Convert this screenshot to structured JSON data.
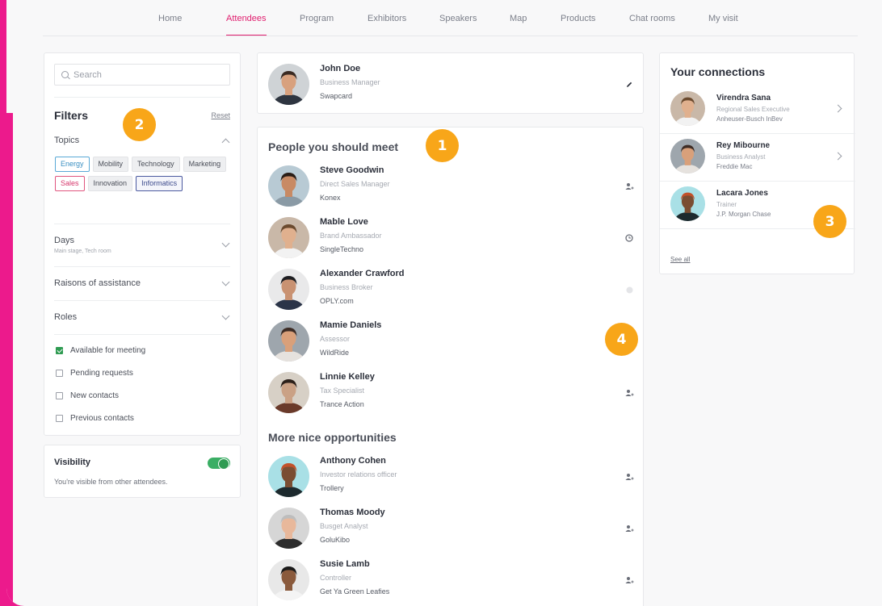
{
  "nav": {
    "items": [
      "Home",
      "Attendees",
      "Program",
      "Exhibitors",
      "Speakers",
      "Map",
      "Products",
      "Chat rooms",
      "My visit"
    ],
    "active": "Attendees"
  },
  "filters": {
    "search_placeholder": "Search",
    "title": "Filters",
    "reset": "Reset",
    "topics_label": "Topics",
    "tags": [
      {
        "label": "Energy",
        "style": "blue"
      },
      {
        "label": "Mobility",
        "style": "plain"
      },
      {
        "label": "Technology",
        "style": "plain"
      },
      {
        "label": "Marketing",
        "style": "plain"
      },
      {
        "label": "Sales",
        "style": "pink"
      },
      {
        "label": "Innovation",
        "style": "plain"
      },
      {
        "label": "Informatics",
        "style": "navy"
      }
    ],
    "days_label": "Days",
    "days_sub": "Main stage, Tech room",
    "raisons_label": "Raisons of assistance",
    "roles_label": "Roles",
    "checks": [
      {
        "label": "Available for meeting",
        "checked": true
      },
      {
        "label": "Pending requests",
        "checked": false
      },
      {
        "label": "New contacts",
        "checked": false
      },
      {
        "label": "Previous contacts",
        "checked": false
      }
    ]
  },
  "visibility": {
    "title": "Visibility",
    "subtitle": "You're visible from other attendees.",
    "enabled": true
  },
  "me": {
    "name": "John Doe",
    "role": "Business Manager",
    "company": "Swapcard"
  },
  "people": {
    "section1_title": "People you should meet",
    "section2_title": "More nice opportunities",
    "list1": [
      {
        "name": "Steve Goodwin",
        "role": "Direct Sales Manager",
        "company": "Konex",
        "icon": "person-add-icon"
      },
      {
        "name": "Mable Love",
        "role": "Brand Ambassador",
        "company": "SingleTechno",
        "icon": "clock-icon"
      },
      {
        "name": "Alexander Crawford",
        "role": "Business Broker",
        "company": "OPLY.com",
        "icon": "dot-icon"
      },
      {
        "name": "Mamie Daniels",
        "role": "Assessor",
        "company": "WildRide",
        "icon": ""
      },
      {
        "name": "Linnie Kelley",
        "role": "Tax Specialist",
        "company": "Trance Action",
        "icon": "person-add-icon"
      }
    ],
    "list2": [
      {
        "name": "Anthony Cohen",
        "role": "Investor relations officer",
        "company": "Trollery",
        "icon": "person-add-icon"
      },
      {
        "name": "Thomas Moody",
        "role": "Busget Analyst",
        "company": "GoluKibo",
        "icon": "person-add-icon"
      },
      {
        "name": "Susie Lamb",
        "role": "Controller",
        "company": "Get Ya Green Leafies",
        "icon": "person-add-icon"
      }
    ]
  },
  "connections": {
    "title": "Your connections",
    "items": [
      {
        "name": "Virendra Sana",
        "role": "Regional Sales Executive",
        "company": "Anheuser-Busch InBev"
      },
      {
        "name": "Rey Mibourne",
        "role": "Business Analyst",
        "company": "Freddie Mac"
      },
      {
        "name": "Lacara Jones",
        "role": "Trainer",
        "company": "J.P. Morgan Chase"
      }
    ],
    "see_all": "See all"
  },
  "badges": [
    "1",
    "2",
    "3",
    "4"
  ],
  "colors": {
    "accent": "#e01f6f",
    "brand_pink": "#ec1a8c",
    "badge": "#f8a619",
    "toggle": "#3aae64"
  }
}
